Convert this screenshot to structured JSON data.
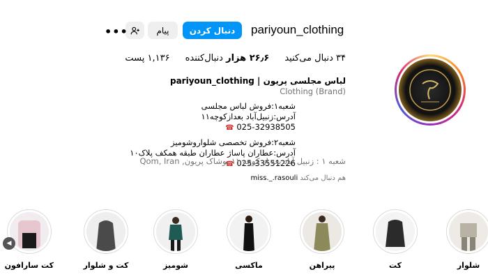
{
  "header": {
    "username": "pariyoun_clothing",
    "follow_label": "دنبال کردن",
    "message_label": "پیام"
  },
  "stats": {
    "posts": "۱,۱۳۶ پست",
    "followers_count": "۲۶٫۶ هزار",
    "followers_label": "دنبال‌کننده",
    "following": "۳۴ دنبال می‌کنید"
  },
  "bio": {
    "name": "لباس مجلسی پریون | pariyoun_clothing",
    "category": "Clothing (Brand)",
    "lines": [
      "شعبه۱:فروش لباس مجلسی",
      "آدرس:زنبیل‌آباد بعدازکوچه۱۱"
    ],
    "phone1": "025-32938505",
    "lines2": [
      "شعبه۲:فروش تخصصی شلواروشومیز",
      "آدرس:عطاران پاساژ عطاران طبقه همکف پلاک۱۰"
    ],
    "phone2": "025-33551226",
    "address": "شعبه ۱ : زنبیل آباد بعد از کوچه ۱۱ پوشاک پریون, Qom, Iran",
    "followed_by_user": "miss._.rasouli",
    "followed_by_label": "هم دنبال می‌کند"
  },
  "stories": [
    {
      "label": "کت سارافون"
    },
    {
      "label": "کت و شلوار"
    },
    {
      "label": "شومیز"
    },
    {
      "label": "ماکسی"
    },
    {
      "label": "پیراهن"
    },
    {
      "label": "کت"
    },
    {
      "label": "شلوار"
    }
  ]
}
